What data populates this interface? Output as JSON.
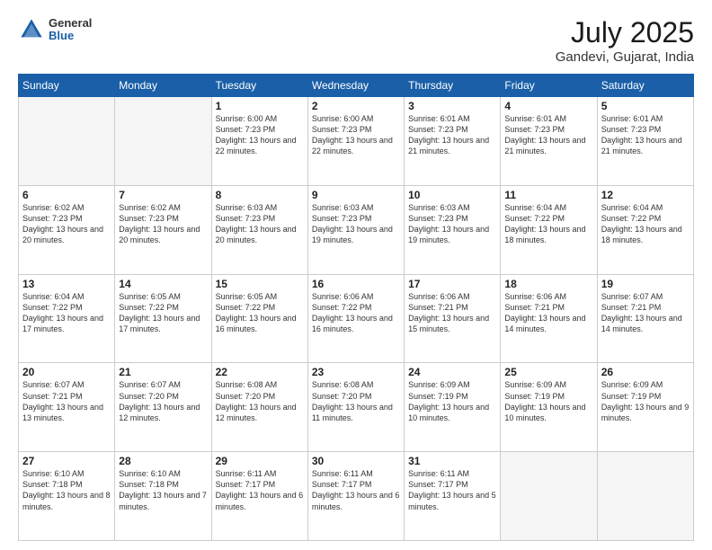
{
  "header": {
    "logo_general": "General",
    "logo_blue": "Blue",
    "title": "July 2025",
    "location": "Gandevi, Gujarat, India"
  },
  "days_of_week": [
    "Sunday",
    "Monday",
    "Tuesday",
    "Wednesday",
    "Thursday",
    "Friday",
    "Saturday"
  ],
  "weeks": [
    [
      {
        "day": "",
        "empty": true
      },
      {
        "day": "",
        "empty": true
      },
      {
        "day": "1",
        "info": "Sunrise: 6:00 AM\nSunset: 7:23 PM\nDaylight: 13 hours\nand 22 minutes."
      },
      {
        "day": "2",
        "info": "Sunrise: 6:00 AM\nSunset: 7:23 PM\nDaylight: 13 hours\nand 22 minutes."
      },
      {
        "day": "3",
        "info": "Sunrise: 6:01 AM\nSunset: 7:23 PM\nDaylight: 13 hours\nand 21 minutes."
      },
      {
        "day": "4",
        "info": "Sunrise: 6:01 AM\nSunset: 7:23 PM\nDaylight: 13 hours\nand 21 minutes."
      },
      {
        "day": "5",
        "info": "Sunrise: 6:01 AM\nSunset: 7:23 PM\nDaylight: 13 hours\nand 21 minutes."
      }
    ],
    [
      {
        "day": "6",
        "info": "Sunrise: 6:02 AM\nSunset: 7:23 PM\nDaylight: 13 hours\nand 20 minutes."
      },
      {
        "day": "7",
        "info": "Sunrise: 6:02 AM\nSunset: 7:23 PM\nDaylight: 13 hours\nand 20 minutes."
      },
      {
        "day": "8",
        "info": "Sunrise: 6:03 AM\nSunset: 7:23 PM\nDaylight: 13 hours\nand 20 minutes."
      },
      {
        "day": "9",
        "info": "Sunrise: 6:03 AM\nSunset: 7:23 PM\nDaylight: 13 hours\nand 19 minutes."
      },
      {
        "day": "10",
        "info": "Sunrise: 6:03 AM\nSunset: 7:23 PM\nDaylight: 13 hours\nand 19 minutes."
      },
      {
        "day": "11",
        "info": "Sunrise: 6:04 AM\nSunset: 7:22 PM\nDaylight: 13 hours\nand 18 minutes."
      },
      {
        "day": "12",
        "info": "Sunrise: 6:04 AM\nSunset: 7:22 PM\nDaylight: 13 hours\nand 18 minutes."
      }
    ],
    [
      {
        "day": "13",
        "info": "Sunrise: 6:04 AM\nSunset: 7:22 PM\nDaylight: 13 hours\nand 17 minutes."
      },
      {
        "day": "14",
        "info": "Sunrise: 6:05 AM\nSunset: 7:22 PM\nDaylight: 13 hours\nand 17 minutes."
      },
      {
        "day": "15",
        "info": "Sunrise: 6:05 AM\nSunset: 7:22 PM\nDaylight: 13 hours\nand 16 minutes."
      },
      {
        "day": "16",
        "info": "Sunrise: 6:06 AM\nSunset: 7:22 PM\nDaylight: 13 hours\nand 16 minutes."
      },
      {
        "day": "17",
        "info": "Sunrise: 6:06 AM\nSunset: 7:21 PM\nDaylight: 13 hours\nand 15 minutes."
      },
      {
        "day": "18",
        "info": "Sunrise: 6:06 AM\nSunset: 7:21 PM\nDaylight: 13 hours\nand 14 minutes."
      },
      {
        "day": "19",
        "info": "Sunrise: 6:07 AM\nSunset: 7:21 PM\nDaylight: 13 hours\nand 14 minutes."
      }
    ],
    [
      {
        "day": "20",
        "info": "Sunrise: 6:07 AM\nSunset: 7:21 PM\nDaylight: 13 hours\nand 13 minutes."
      },
      {
        "day": "21",
        "info": "Sunrise: 6:07 AM\nSunset: 7:20 PM\nDaylight: 13 hours\nand 12 minutes."
      },
      {
        "day": "22",
        "info": "Sunrise: 6:08 AM\nSunset: 7:20 PM\nDaylight: 13 hours\nand 12 minutes."
      },
      {
        "day": "23",
        "info": "Sunrise: 6:08 AM\nSunset: 7:20 PM\nDaylight: 13 hours\nand 11 minutes."
      },
      {
        "day": "24",
        "info": "Sunrise: 6:09 AM\nSunset: 7:19 PM\nDaylight: 13 hours\nand 10 minutes."
      },
      {
        "day": "25",
        "info": "Sunrise: 6:09 AM\nSunset: 7:19 PM\nDaylight: 13 hours\nand 10 minutes."
      },
      {
        "day": "26",
        "info": "Sunrise: 6:09 AM\nSunset: 7:19 PM\nDaylight: 13 hours\nand 9 minutes."
      }
    ],
    [
      {
        "day": "27",
        "info": "Sunrise: 6:10 AM\nSunset: 7:18 PM\nDaylight: 13 hours\nand 8 minutes."
      },
      {
        "day": "28",
        "info": "Sunrise: 6:10 AM\nSunset: 7:18 PM\nDaylight: 13 hours\nand 7 minutes."
      },
      {
        "day": "29",
        "info": "Sunrise: 6:11 AM\nSunset: 7:17 PM\nDaylight: 13 hours\nand 6 minutes."
      },
      {
        "day": "30",
        "info": "Sunrise: 6:11 AM\nSunset: 7:17 PM\nDaylight: 13 hours\nand 6 minutes."
      },
      {
        "day": "31",
        "info": "Sunrise: 6:11 AM\nSunset: 7:17 PM\nDaylight: 13 hours\nand 5 minutes."
      },
      {
        "day": "",
        "empty": true
      },
      {
        "day": "",
        "empty": true
      }
    ]
  ]
}
